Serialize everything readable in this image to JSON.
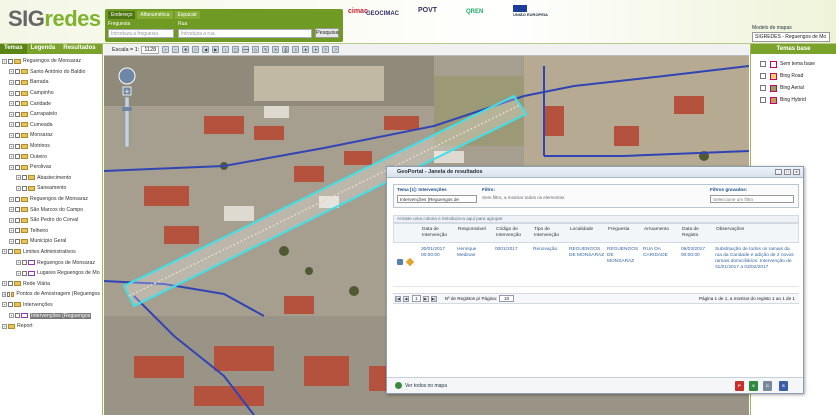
{
  "header": {
    "logo_text": "SIG",
    "logo_accent": "redes",
    "search_tabs": [
      "Endereço",
      "Alfanumérica",
      "Espacial"
    ],
    "freguesia_label": "Freguesia",
    "freguesia_placeholder": "Introduza a freguesia",
    "rua_label": "Rua",
    "rua_placeholder": "Introduza a rua",
    "search_button": "Pesquisa",
    "partners": [
      "cimac",
      "GEOCIMAC",
      "POVT",
      "QREN",
      "UNIÃO EUROPEIA"
    ],
    "mapas_label": "Modelo de mapas",
    "mapas_value": "SIGREDES - Reguengos de Mo"
  },
  "left_panel": {
    "tabs": [
      "Temas",
      "Legenda",
      "Resultados"
    ],
    "tree": [
      {
        "label": "Reguengos de Monsaraz",
        "indent": 0,
        "folder": true,
        "check": true
      },
      {
        "label": "Santo António do Baldio",
        "indent": 1,
        "folder": true,
        "check": true
      },
      {
        "label": "Barrada",
        "indent": 1,
        "folder": true,
        "check": true
      },
      {
        "label": "Campinho",
        "indent": 1,
        "folder": true,
        "check": true
      },
      {
        "label": "Caridade",
        "indent": 1,
        "folder": true,
        "check": true
      },
      {
        "label": "Carrapatelo",
        "indent": 1,
        "folder": true,
        "check": true
      },
      {
        "label": "Cumeada",
        "indent": 1,
        "folder": true,
        "check": true
      },
      {
        "label": "Monsaraz",
        "indent": 1,
        "folder": true,
        "check": true
      },
      {
        "label": "Motrinos",
        "indent": 1,
        "folder": true,
        "check": true
      },
      {
        "label": "Outeiro",
        "indent": 1,
        "folder": true,
        "check": true
      },
      {
        "label": "Perolivas",
        "indent": 1,
        "folder": true,
        "check": true
      },
      {
        "label": "Abastecimento",
        "indent": 2,
        "folder": true,
        "check": true
      },
      {
        "label": "Saneamento",
        "indent": 2,
        "folder": true,
        "check": true
      },
      {
        "label": "Reguengos de Monsaraz",
        "indent": 1,
        "folder": true,
        "check": true
      },
      {
        "label": "São Marcos do Campo",
        "indent": 1,
        "folder": true,
        "check": true
      },
      {
        "label": "São Pedro do Corval",
        "indent": 1,
        "folder": true,
        "check": true
      },
      {
        "label": "Telheiro",
        "indent": 1,
        "folder": true,
        "check": true
      },
      {
        "label": "Município Geral",
        "indent": 1,
        "folder": true,
        "check": true
      },
      {
        "label": "Limites Administrativos",
        "indent": 0,
        "folder": true,
        "check": true
      },
      {
        "label": "Reguengos de Monsaraz",
        "indent": 2,
        "folder": false,
        "check": true
      },
      {
        "label": "Lugares Reguengos de Mo",
        "indent": 2,
        "folder": false,
        "check": true
      },
      {
        "label": "Rede Viária",
        "indent": 0,
        "folder": true,
        "check": true
      },
      {
        "label": "Pontos de Amostragem (Reguengos",
        "indent": 0,
        "folder": true,
        "check": true
      },
      {
        "label": "Intervenções",
        "indent": 0,
        "folder": true,
        "check": true
      },
      {
        "label": "Intervenções (Reguengos",
        "indent": 1,
        "folder": false,
        "check": true,
        "selected": true
      },
      {
        "label": "Report",
        "indent": 0,
        "folder": true,
        "check": false
      }
    ]
  },
  "toolbar": {
    "scale_label": "Escala = 1:",
    "scale_value": "1128"
  },
  "right_panel": {
    "title": "Temas base",
    "items": [
      {
        "label": "Sem tema base",
        "color": "#ffffff"
      },
      {
        "label": "Bing Road",
        "color": "#f2d36b"
      },
      {
        "label": "Bing Aerial",
        "color": "#8aa55a"
      },
      {
        "label": "Bing Hybrid",
        "color": "#c59b5a"
      }
    ]
  },
  "results": {
    "title": "GeoPortal - Janela de resultados",
    "tema_label": "Tema [1]: Intervenções",
    "tema_value": "Intervenções (Reguengos de",
    "filtro_label": "Filtro:",
    "filtro_text": "Sem filtro, a mostrar todos os elementos",
    "filtros_gravados_label": "Filtros gravados:",
    "filtros_gravados_value": "Seleccione um filtro",
    "drag_hint": "Arraste uma coluna e introduza-a aqui para agrupar",
    "columns": [
      "Data de Intervenção",
      "Responsável",
      "Código de Intervenção",
      "Tipo de Intervenção",
      "Localidade",
      "Freguesia",
      "Arruamento",
      "Data de Registo",
      "Observações"
    ],
    "row": [
      "30/01/2017 00:00:00",
      "Henrique Medinas",
      "0001/2017",
      "Renovação",
      "REGUENGOS DE MONSARAZ",
      "REGUENGOS DE MONSARAZ",
      "RUA DA CARIDADE",
      "06/03/2017 00:00:00",
      "Substituição de todos os ramais da rua da Caridade e adição de 2 novos ramais domiciliários. Intervenção de 31/01/2017 a 03/02/2017"
    ],
    "pager_page": "1",
    "pager_per_page_label": "Nº de Registos p/ Página:",
    "pager_per_page": "10",
    "pager_summary": "Página 1 de 1, a mostrar do registo 1 ao 1 de 1",
    "see_on_map": "Ver todos no mapa"
  }
}
